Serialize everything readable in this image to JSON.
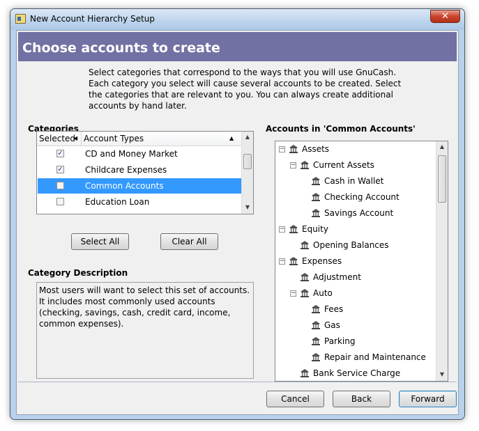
{
  "window": {
    "title": "New Account Hierarchy Setup",
    "close_glyph": "✕"
  },
  "header": {
    "title": "Choose accounts to create"
  },
  "intro_text": "Select categories that correspond to the ways that you will use GnuCash.  Each category you select will cause several accounts to be created.  Select the categories that are relevant to you.  You can always create additional accounts by hand later.",
  "categories": {
    "label": "Categories",
    "columns": [
      "Selected",
      "Account Types"
    ],
    "rows": [
      {
        "label": "CD and Money Market",
        "checked": true,
        "selected": false
      },
      {
        "label": "Childcare Expenses",
        "checked": true,
        "selected": false
      },
      {
        "label": "Common Accounts",
        "checked": false,
        "selected": true
      },
      {
        "label": "Education Loan",
        "checked": false,
        "selected": false
      }
    ],
    "select_all": "Select All",
    "clear_all": "Clear All"
  },
  "description": {
    "label": "Category Description",
    "text": "Most users will want to select this set of accounts. It includes most commonly used accounts (checking, savings, cash, credit card, income, common expenses)."
  },
  "accounts": {
    "label": "Accounts in 'Common Accounts'",
    "items": [
      {
        "label": "Assets",
        "level": 0,
        "expandable": true
      },
      {
        "label": "Current Assets",
        "level": 1,
        "expandable": true
      },
      {
        "label": "Cash in Wallet",
        "level": 2,
        "expandable": false
      },
      {
        "label": "Checking Account",
        "level": 2,
        "expandable": false
      },
      {
        "label": "Savings Account",
        "level": 2,
        "expandable": false
      },
      {
        "label": "Equity",
        "level": 0,
        "expandable": true
      },
      {
        "label": "Opening Balances",
        "level": 1,
        "expandable": false
      },
      {
        "label": "Expenses",
        "level": 0,
        "expandable": true
      },
      {
        "label": "Adjustment",
        "level": 1,
        "expandable": false
      },
      {
        "label": "Auto",
        "level": 1,
        "expandable": true
      },
      {
        "label": "Fees",
        "level": 2,
        "expandable": false
      },
      {
        "label": "Gas",
        "level": 2,
        "expandable": false
      },
      {
        "label": "Parking",
        "level": 2,
        "expandable": false
      },
      {
        "label": "Repair and Maintenance",
        "level": 2,
        "expandable": false
      },
      {
        "label": "Bank Service Charge",
        "level": 1,
        "expandable": false
      }
    ]
  },
  "footer": {
    "cancel": "Cancel",
    "back": "Back",
    "forward": "Forward"
  },
  "glyphs": {
    "check": "✓",
    "minus": "−",
    "up": "▲",
    "down": "▼",
    "sort_left": "◀",
    "sort_up": "▲"
  }
}
